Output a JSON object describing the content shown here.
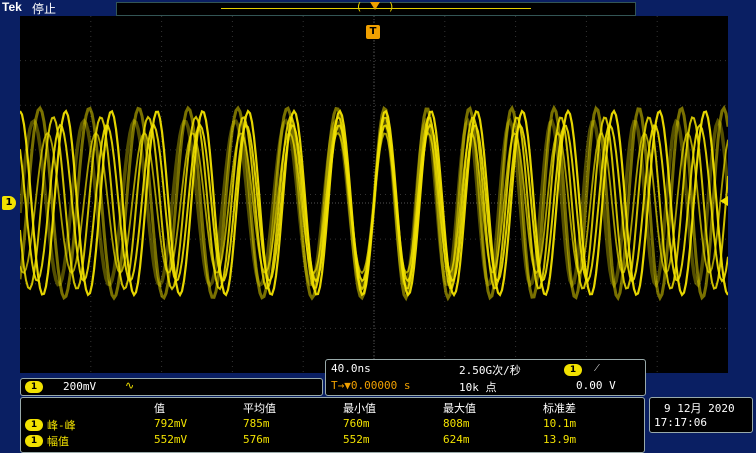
{
  "header": {
    "brand": "Tek",
    "acq_state": "停止",
    "bracket_left": "(",
    "bracket_right": ")",
    "trigger_marker": "T"
  },
  "waveform": {
    "channel_marker": "1",
    "color": "#f2e200"
  },
  "channel_panel": {
    "badge": "1",
    "scale": "200mV",
    "coupling_symbol": "∿"
  },
  "timebase_panel": {
    "time_per_div": "40.0ns",
    "sample_rate": "2.50G次/秒",
    "trigger_pos_label": "T→▼0.00000 s",
    "record_length": "10k 点",
    "trigger_source_badge": "1",
    "trigger_slope_symbol": "⁄",
    "trigger_level": "0.00 V"
  },
  "measurements": {
    "headers": [
      "值",
      "平均值",
      "最小值",
      "最大值",
      "标准差"
    ],
    "rows": [
      {
        "badge": "1",
        "name": "峰-峰",
        "values": [
          "792mV",
          "785m",
          "760m",
          "808m",
          "10.1m"
        ]
      },
      {
        "badge": "1",
        "name": "幅值",
        "values": [
          "552mV",
          "576m",
          "552m",
          "624m",
          "13.9m"
        ]
      }
    ]
  },
  "datetime": {
    "date": "9 12月  2020",
    "time": "17:17:06"
  }
}
